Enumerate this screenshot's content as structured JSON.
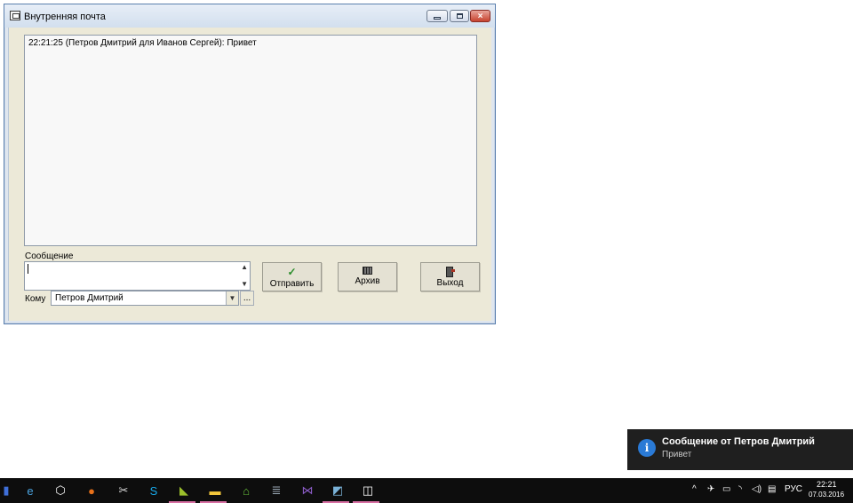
{
  "window": {
    "title": "Внутренняя почта",
    "controls": {
      "minimize": "–",
      "maximize": "□",
      "close": "×"
    }
  },
  "log": {
    "lines": [
      "22:21:25 (Петров Дмитрий для Иванов Сергей): Привет"
    ]
  },
  "message": {
    "label": "Сообщение",
    "value": ""
  },
  "recipient": {
    "label": "Кому",
    "selected": "Петров Дмитрий",
    "browse_label": "..."
  },
  "buttons": {
    "send": "Отправить",
    "archive": "Архив",
    "exit": "Выход"
  },
  "toast": {
    "title": "Сообщение от Петров Дмитрий",
    "body": "Привет",
    "icon_glyph": "i",
    "icon_color": "#2a7ad6"
  },
  "taskbar": {
    "apps": [
      {
        "name": "save-app-icon",
        "glyph": "▮",
        "color": "#3f6fd8"
      },
      {
        "name": "internet-explorer-icon",
        "glyph": "e",
        "color": "#4aa3df"
      },
      {
        "name": "virtualbox-icon",
        "glyph": "⬡",
        "color": "#ffffff"
      },
      {
        "name": "firefox-icon",
        "glyph": "●",
        "color": "#e8711a"
      },
      {
        "name": "tools-icon",
        "glyph": "✂",
        "color": "#d9d9d9"
      },
      {
        "name": "skype-icon",
        "glyph": "S",
        "color": "#17a7e8"
      },
      {
        "name": "media-app-icon",
        "glyph": "◣",
        "color": "#9bbf2b"
      },
      {
        "name": "file-explorer-icon",
        "glyph": "▬",
        "color": "#f3c73b"
      },
      {
        "name": "home-app-icon",
        "glyph": "⌂",
        "color": "#67c23a"
      },
      {
        "name": "database-app-icon",
        "glyph": "≣",
        "color": "#9aa8b5"
      },
      {
        "name": "visual-studio-icon",
        "glyph": "⋈",
        "color": "#8b5cc7"
      },
      {
        "name": "notes-app-icon",
        "glyph": "◩",
        "color": "#7ab2d8"
      },
      {
        "name": "mail-app-icon",
        "glyph": "◫",
        "color": "#ffffff"
      }
    ],
    "tray": {
      "language": "РУС",
      "time": "22:21",
      "date": "07.03.2016"
    }
  }
}
